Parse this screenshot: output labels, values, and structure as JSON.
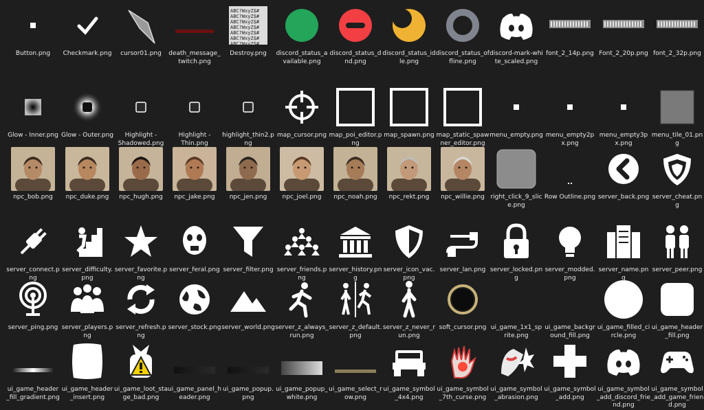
{
  "window": {
    "view": "Large icons"
  },
  "files": [
    {
      "name": "Button.png",
      "icon": "small-square"
    },
    {
      "name": "Checkmark.png",
      "icon": "checkmark"
    },
    {
      "name": "cursor01.png",
      "icon": "stone-arrowhead"
    },
    {
      "name": "death_message_twitch.png",
      "icon": "red-blur-strip"
    },
    {
      "name": "Destroy.png",
      "icon": "glyph-sheet"
    },
    {
      "name": "discord_status_available.png",
      "icon": "green-circle",
      "color": "#23a55a"
    },
    {
      "name": "discord_status_dnd.png",
      "icon": "red-minus-circle",
      "color": "#f23f43"
    },
    {
      "name": "discord_status_idle.png",
      "icon": "yellow-moon",
      "color": "#f0b232"
    },
    {
      "name": "discord_status_offline.png",
      "icon": "grey-ring",
      "color": "#80848e"
    },
    {
      "name": "discord-mark-white_scaled.png",
      "icon": "discord-icon"
    },
    {
      "name": "font_2_14p.png",
      "icon": "font-strip"
    },
    {
      "name": "Font_2_20p.png",
      "icon": "font-strip"
    },
    {
      "name": "font_2_32p.png",
      "icon": "font-strip"
    },
    {
      "name": "Glow - Inner.png",
      "icon": "inner-glow"
    },
    {
      "name": "Glow - Outer.png",
      "icon": "outer-glow"
    },
    {
      "name": "Highlight - Shadowed.png",
      "icon": "highlight-square"
    },
    {
      "name": "Highlight - Thin.png",
      "icon": "highlight-square"
    },
    {
      "name": "highlight_thin2.png",
      "icon": "highlight-square"
    },
    {
      "name": "map_cursor.png",
      "icon": "crosshair-icon"
    },
    {
      "name": "map_poi_editor.png",
      "icon": "white-frame"
    },
    {
      "name": "map_spawn.png",
      "icon": "white-frame"
    },
    {
      "name": "map_static_spawner_editor.png",
      "icon": "white-frame"
    },
    {
      "name": "menu_empty.png",
      "icon": "small-square"
    },
    {
      "name": "menu_empty2px.png",
      "icon": "small-square"
    },
    {
      "name": "menu_empty3px.png",
      "icon": "small-square"
    },
    {
      "name": "menu_tile_01.png",
      "icon": "grey-tile"
    },
    {
      "name": "npc_bob.png",
      "icon": "portrait"
    },
    {
      "name": "npc_duke.png",
      "icon": "portrait"
    },
    {
      "name": "npc_hugh.png",
      "icon": "portrait"
    },
    {
      "name": "npc_jake.png",
      "icon": "portrait"
    },
    {
      "name": "npc_jen.png",
      "icon": "portrait"
    },
    {
      "name": "npc_joel.png",
      "icon": "portrait"
    },
    {
      "name": "npc_noah.png",
      "icon": "portrait"
    },
    {
      "name": "npc_rekt.png",
      "icon": "portrait"
    },
    {
      "name": "npc_willie.png",
      "icon": "portrait"
    },
    {
      "name": "right_click_9_slice.png",
      "icon": "rounded-grey-tile"
    },
    {
      "name": "Row Outline.png",
      "icon": "tiny-dots"
    },
    {
      "name": "server_back.png",
      "icon": "back-circle-icon"
    },
    {
      "name": "server_cheat.png",
      "icon": "shield-icon"
    },
    {
      "name": "server_connect.png",
      "icon": "plug-icon"
    },
    {
      "name": "server_difficulty.png",
      "icon": "climber-icon"
    },
    {
      "name": "server_favorite.png",
      "icon": "star-icon"
    },
    {
      "name": "server_feral.png",
      "icon": "zombie-face-icon"
    },
    {
      "name": "server_filter.png",
      "icon": "filter-icon"
    },
    {
      "name": "server_friends.png",
      "icon": "friends-icon"
    },
    {
      "name": "server_history.png",
      "icon": "bank-icon"
    },
    {
      "name": "server_icon_vac.png",
      "icon": "vac-shield-icon"
    },
    {
      "name": "server_lan.png",
      "icon": "lan-cable-icon"
    },
    {
      "name": "server_locked.png",
      "icon": "lock-icon"
    },
    {
      "name": "server_modded.png",
      "icon": "lightbulb-icon"
    },
    {
      "name": "server_name.png",
      "icon": "server-rack-icon"
    },
    {
      "name": "server_peer.png",
      "icon": "peers-icon"
    },
    {
      "name": "server_ping.png",
      "icon": "ping-icon"
    },
    {
      "name": "server_players.png",
      "icon": "players-icon"
    },
    {
      "name": "server_refresh.png",
      "icon": "refresh-icon"
    },
    {
      "name": "server_stock.png",
      "icon": "globe-icon"
    },
    {
      "name": "server_world.png",
      "icon": "mountains-icon"
    },
    {
      "name": "server_z_always_run.png",
      "icon": "runner-icon"
    },
    {
      "name": "server_z_default.png",
      "icon": "walk-run-icon"
    },
    {
      "name": "server_z_never_run.png",
      "icon": "walker-icon"
    },
    {
      "name": "soft_cursor.png",
      "icon": "ring-icon"
    },
    {
      "name": "ui_game_1x1_sprite.png",
      "icon": "blank"
    },
    {
      "name": "ui_game_background_fill.png",
      "icon": "blank"
    },
    {
      "name": "ui_game_filled_circle.png",
      "icon": "white-circle"
    },
    {
      "name": "ui_game_header_fill.png",
      "icon": "white-rounded-square"
    },
    {
      "name": "ui_game_header_fill_gradient.png",
      "icon": "gradient-strip"
    },
    {
      "name": "ui_game_header_insert.png",
      "icon": "white-shield-shape"
    },
    {
      "name": "ui_game_loot_stage_bad.png",
      "icon": "loot-warning-icon"
    },
    {
      "name": "ui_game_panel_header.png",
      "icon": "dark-strip"
    },
    {
      "name": "ui_game_popup.png",
      "icon": "dark-strip"
    },
    {
      "name": "ui_game_popup_white.png",
      "icon": "grey-gradient-block"
    },
    {
      "name": "ui_game_select_row.png",
      "icon": "tan-strip"
    },
    {
      "name": "ui_game_symbol_4x4.png",
      "icon": "jeep-icon"
    },
    {
      "name": "ui_game_symbol_7th_curse.png",
      "icon": "cursed-hand-icon"
    },
    {
      "name": "ui_game_symbol_abrasion.png",
      "icon": "abrasion-icon"
    },
    {
      "name": "ui_game_symbol_add.png",
      "icon": "plus-icon"
    },
    {
      "name": "ui_game_symbol_add_discord_friend.png",
      "icon": "discord-icon"
    },
    {
      "name": "ui_game_symbol_add_game_friend.png",
      "icon": "gamepad-icon"
    }
  ]
}
